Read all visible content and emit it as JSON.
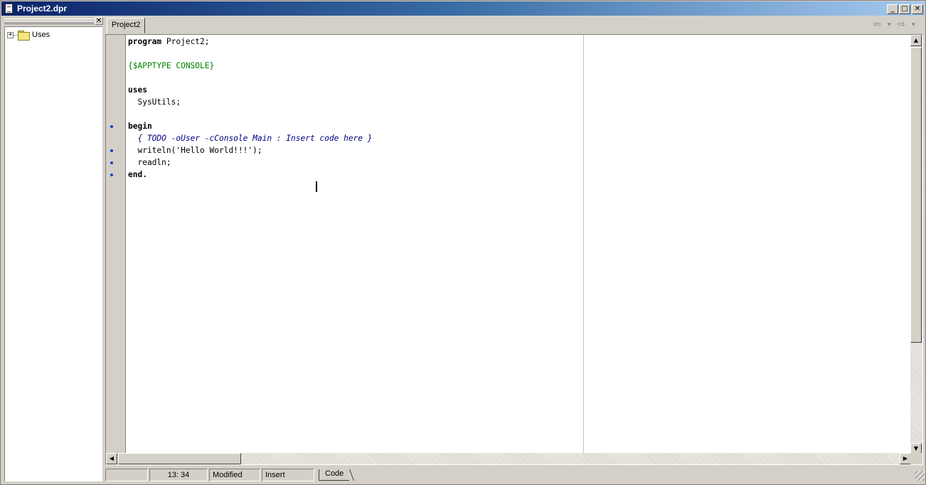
{
  "window": {
    "title": "Project2.dpr",
    "minimize_glyph": "_",
    "maximize_glyph": "□",
    "close_glyph": "✕"
  },
  "project_panel": {
    "close_glyph": "✕",
    "tree": [
      {
        "label": "Uses",
        "expander": "+",
        "icon": "folder-icon"
      }
    ]
  },
  "editor": {
    "tabs": [
      {
        "label": "Project2"
      }
    ],
    "nav": {
      "back_glyph": "⇦",
      "forward_glyph": "⇨",
      "dropdown_glyph": "▾"
    },
    "code_lines": [
      {
        "segments": [
          {
            "t": "program",
            "k": "kw"
          },
          {
            "t": " Project2;",
            "k": ""
          }
        ],
        "dot": false
      },
      {
        "segments": [],
        "dot": false
      },
      {
        "segments": [
          {
            "t": "{$APPTYPE CONSOLE}",
            "k": "dir"
          }
        ],
        "dot": false
      },
      {
        "segments": [],
        "dot": false
      },
      {
        "segments": [
          {
            "t": "uses",
            "k": "kw"
          }
        ],
        "dot": false
      },
      {
        "segments": [
          {
            "t": "  SysUtils;",
            "k": ""
          }
        ],
        "dot": false
      },
      {
        "segments": [],
        "dot": false
      },
      {
        "segments": [
          {
            "t": "begin",
            "k": "kw"
          }
        ],
        "dot": true
      },
      {
        "segments": [
          {
            "t": "  { TODO -oUser -cConsole Main : Insert code here }",
            "k": "cmt"
          }
        ],
        "dot": false
      },
      {
        "segments": [
          {
            "t": "  writeln('Hello World!!!');",
            "k": ""
          }
        ],
        "dot": true
      },
      {
        "segments": [
          {
            "t": "  readln;",
            "k": ""
          }
        ],
        "dot": true
      },
      {
        "segments": [
          {
            "t": "end.",
            "k": "kw"
          }
        ],
        "dot": true
      }
    ]
  },
  "statusbar": {
    "position": "13:  34",
    "modified": "Modified",
    "mode": "Insert",
    "view_tab": "Code"
  },
  "colors": {
    "keyword": "#000000",
    "directive": "#008000",
    "comment": "#000080",
    "breakpoint_dot": "#1144cc"
  }
}
